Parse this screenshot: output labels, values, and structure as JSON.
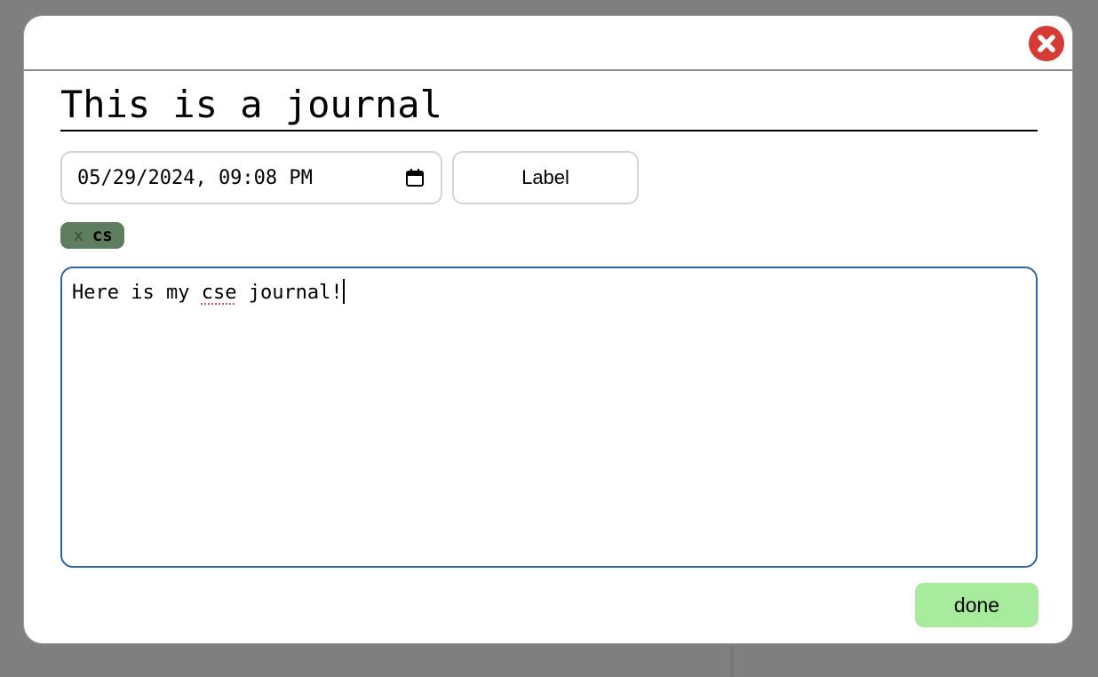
{
  "modal": {
    "title": "This is a journal",
    "datetime": "05/29/2024, 09:08 PM",
    "label_button": "Label",
    "tags": [
      {
        "remove": "x",
        "label": "cs"
      }
    ],
    "body": {
      "before": "Here is my ",
      "misspelled": "cse",
      "after": " journal!"
    },
    "done_button": "done",
    "colors": {
      "close": "#d63a34",
      "tag": "#5f7d5f",
      "done": "#a6eb9b",
      "focus_border": "#2f63a8"
    },
    "icons": {
      "close": "close-circle-icon",
      "calendar": "calendar-icon"
    }
  }
}
